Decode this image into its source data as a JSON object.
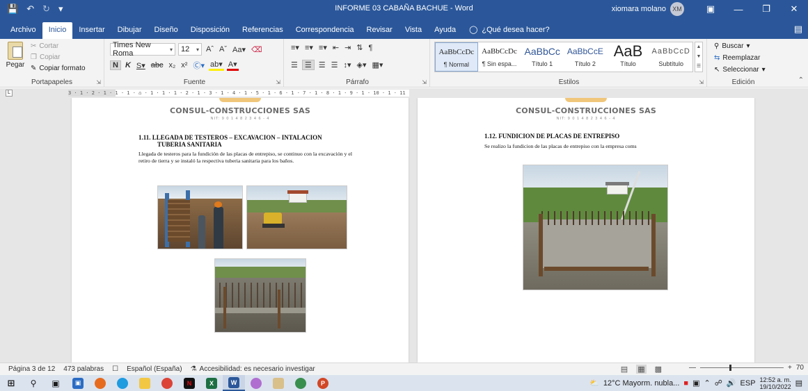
{
  "window": {
    "title": "INFORME 03 CABAÑA BACHUE  -  Word",
    "user": "xiomara molano",
    "user_initials": "XM"
  },
  "tabs": [
    "Archivo",
    "Inicio",
    "Insertar",
    "Dibujar",
    "Diseño",
    "Disposición",
    "Referencias",
    "Correspondencia",
    "Revisar",
    "Vista",
    "Ayuda"
  ],
  "tell_me": "¿Qué desea hacer?",
  "ribbon": {
    "clipboard": {
      "paste": "Pegar",
      "cut": "Cortar",
      "copy": "Copiar",
      "format_painter": "Copiar formato",
      "label": "Portapapeles"
    },
    "font": {
      "family": "Times New Roma",
      "size": "12",
      "label": "Fuente"
    },
    "paragraph": {
      "label": "Párrafo"
    },
    "styles": {
      "label": "Estilos",
      "items": [
        {
          "sample": "AaBbCcDc",
          "name": "¶ Normal"
        },
        {
          "sample": "AaBbCcDc",
          "name": "¶ Sin espa..."
        },
        {
          "sample": "AaBbCc",
          "name": "Título 1"
        },
        {
          "sample": "AaBbCcE",
          "name": "Título 2"
        },
        {
          "sample": "AaB",
          "name": "Título"
        },
        {
          "sample": "AaBbCcD",
          "name": "Subtítulo"
        }
      ]
    },
    "editing": {
      "find": "Buscar",
      "replace": "Reemplazar",
      "select": "Seleccionar",
      "label": "Edición"
    }
  },
  "ruler_text": "3 · 1 · 2 · 1 · 1 · 1 · ⌂ · 1 · 1 · 1 · 2 · 1 · 3 · 1 · 4 · 1 · 5 · 1 · 6 · 1 · 7 · 1 · 8 · 1 · 9 · 1 · 10 · 1 · 11 · 1 · 12 · 1 · 13 · 1 · 14 · 1 · 15 · 16 · 1 · 17 · 1 · 18 · 1",
  "pages": [
    {
      "company": "CONSUL-CONSTRUCCIONES SAS",
      "nit": "NIT: 9 0 1 4 8 2 3 4 6 - 4",
      "heading_line1": "1.11.   LLEGADA DE TESTEROS – EXCAVACION – INTALACION",
      "heading_line2": "TUBERIA SANITARIA",
      "body": "Llegada de testeros para la fundición de las placas de entrepiso, se continuo con la excavación y el retiro de tierra y se instaló la respectiva tuberia sanitaria para los baños."
    },
    {
      "company": "CONSUL-CONSTRUCCIONES SAS",
      "nit": "NIT: 9 0 1 4 8 2 3 4 6 - 4",
      "heading": "1.12.   FUNDICION DE PLACAS DE ENTREPISO",
      "body": "Se realizo la fundicion de las placas de entrepiso con la empresa coms"
    }
  ],
  "status": {
    "page": "Página 3 de 12",
    "words": "473 palabras",
    "language": "Español (España)",
    "accessibility": "Accesibilidad: es necesario investigar",
    "zoom": "70"
  },
  "taskbar": {
    "weather": "12°C  Mayorm. nubla...",
    "lang": "ESP",
    "time": "12:52 a. m.",
    "date": "19/10/2022"
  }
}
